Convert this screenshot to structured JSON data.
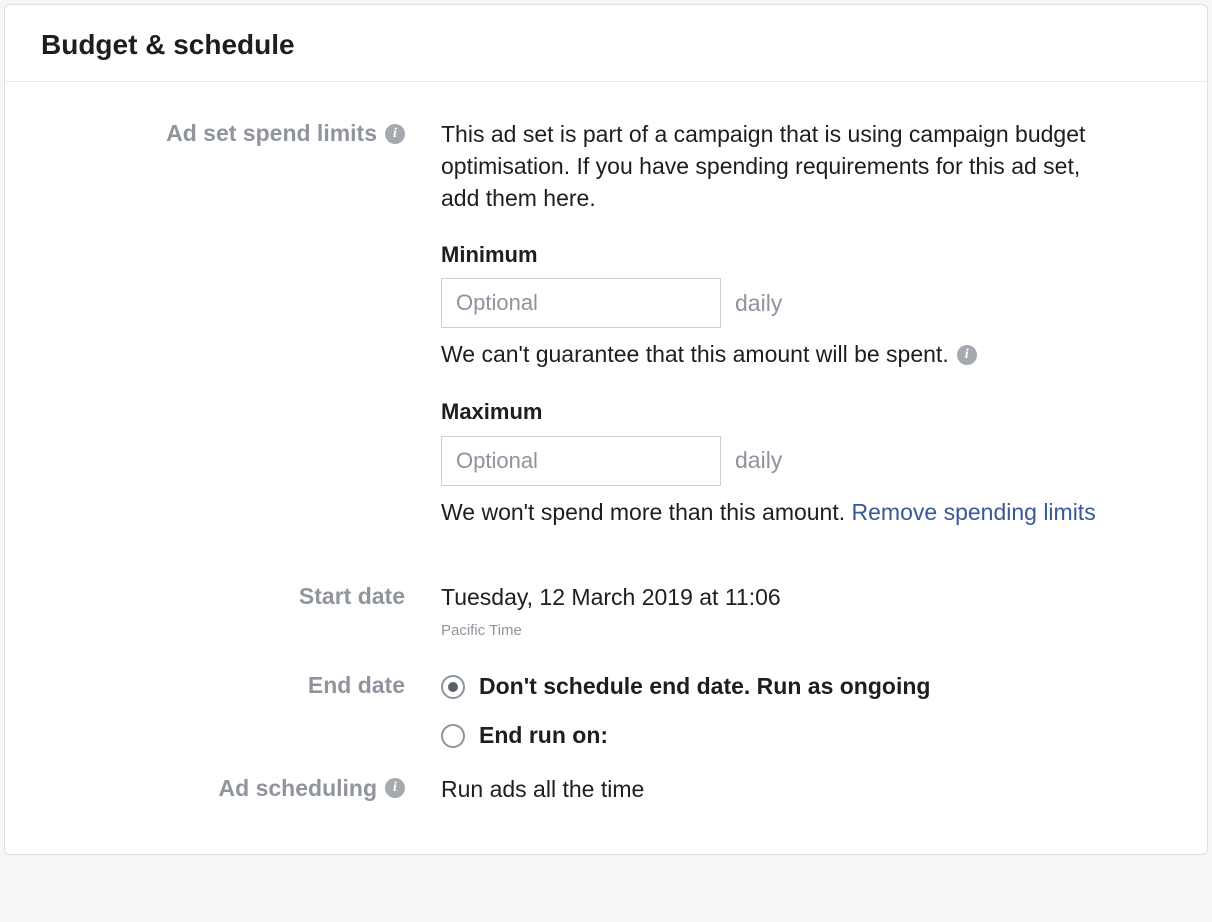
{
  "header": {
    "title": "Budget & schedule"
  },
  "spendLimits": {
    "label": "Ad set spend limits",
    "description": "This ad set is part of a campaign that is using campaign budget optimisation. If you have spending requirements for this ad set, add them here.",
    "minimum": {
      "label": "Minimum",
      "placeholder": "Optional",
      "suffix": "daily",
      "helper": "We can't guarantee that this amount will be spent."
    },
    "maximum": {
      "label": "Maximum",
      "placeholder": "Optional",
      "suffix": "daily",
      "helper": "We won't spend more than this amount."
    },
    "removeLink": "Remove spending limits"
  },
  "startDate": {
    "label": "Start date",
    "value": "Tuesday, 12 March 2019 at 11:06",
    "timezone": "Pacific Time"
  },
  "endDate": {
    "label": "End date",
    "options": [
      {
        "label": "Don't schedule end date. Run as ongoing",
        "checked": true
      },
      {
        "label": "End run on:",
        "checked": false
      }
    ]
  },
  "adScheduling": {
    "label": "Ad scheduling",
    "value": "Run ads all the time"
  }
}
